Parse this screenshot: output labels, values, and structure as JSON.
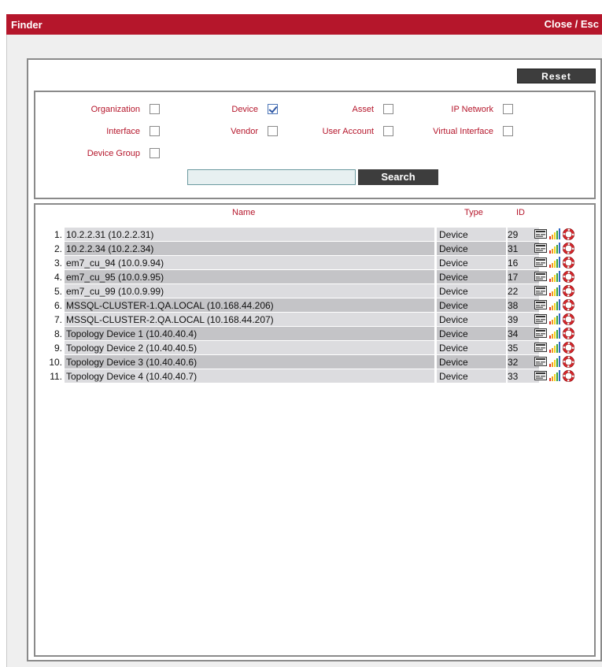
{
  "window": {
    "title": "Finder",
    "close_label": "Close / Esc"
  },
  "toolbar": {
    "reset_label": "Reset"
  },
  "filters": [
    {
      "label": "Organization",
      "checked": false
    },
    {
      "label": "Device",
      "checked": true
    },
    {
      "label": "Asset",
      "checked": false
    },
    {
      "label": "IP Network",
      "checked": false
    },
    {
      "label": "Interface",
      "checked": false
    },
    {
      "label": "Vendor",
      "checked": false
    },
    {
      "label": "User Account",
      "checked": false
    },
    {
      "label": "Virtual Interface",
      "checked": false
    },
    {
      "label": "Device Group",
      "checked": false
    }
  ],
  "search": {
    "value": "",
    "button_label": "Search"
  },
  "results": {
    "columns": {
      "name": "Name",
      "type": "Type",
      "id": "ID"
    },
    "row_icons": [
      "properties-icon",
      "performance-icon",
      "ticket-lifering-icon"
    ],
    "rows": [
      {
        "num": "1.",
        "name": "10.2.2.31 (10.2.2.31)",
        "type": "Device",
        "id": "29"
      },
      {
        "num": "2.",
        "name": "10.2.2.34 (10.2.2.34)",
        "type": "Device",
        "id": "31"
      },
      {
        "num": "3.",
        "name": "em7_cu_94 (10.0.9.94)",
        "type": "Device",
        "id": "16"
      },
      {
        "num": "4.",
        "name": "em7_cu_95 (10.0.9.95)",
        "type": "Device",
        "id": "17"
      },
      {
        "num": "5.",
        "name": "em7_cu_99 (10.0.9.99)",
        "type": "Device",
        "id": "22"
      },
      {
        "num": "6.",
        "name": "MSSQL-CLUSTER-1.QA.LOCAL (10.168.44.206)",
        "type": "Device",
        "id": "38"
      },
      {
        "num": "7.",
        "name": "MSSQL-CLUSTER-2.QA.LOCAL (10.168.44.207)",
        "type": "Device",
        "id": "39"
      },
      {
        "num": "8.",
        "name": "Topology Device 1 (10.40.40.4)",
        "type": "Device",
        "id": "34"
      },
      {
        "num": "9.",
        "name": "Topology Device 2 (10.40.40.5)",
        "type": "Device",
        "id": "35"
      },
      {
        "num": "10.",
        "name": "Topology Device 3 (10.40.40.6)",
        "type": "Device",
        "id": "32"
      },
      {
        "num": "11.",
        "name": "Topology Device 4 (10.40.40.7)",
        "type": "Device",
        "id": "33"
      }
    ]
  },
  "colors": {
    "accent": "#b5162b",
    "button": "#3d3d3d",
    "row_light": "#dcdcdf",
    "row_dark": "#c4c4c7"
  }
}
